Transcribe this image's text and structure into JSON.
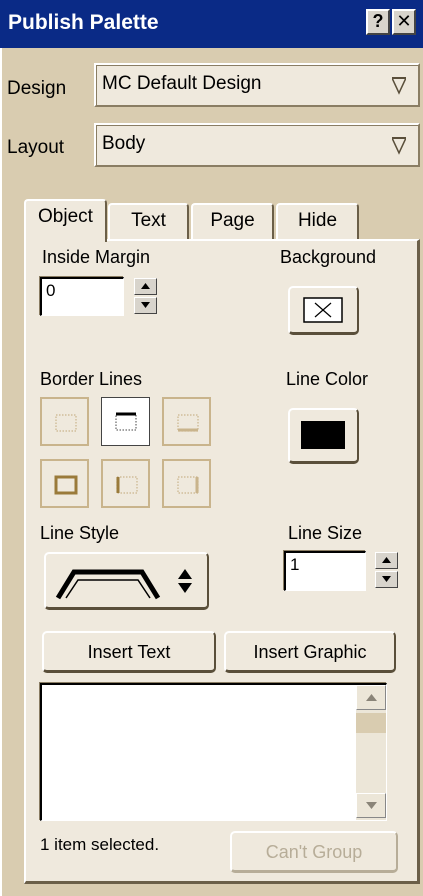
{
  "window": {
    "title": "Publish Palette",
    "help_label": "?",
    "close_label": "✕"
  },
  "design": {
    "label": "Design",
    "value": "MC Default Design"
  },
  "layout": {
    "label": "Layout",
    "value": "Body"
  },
  "tabs": [
    {
      "label": "Object",
      "active": true
    },
    {
      "label": "Text"
    },
    {
      "label": "Page"
    },
    {
      "label": "Hide"
    }
  ],
  "object_panel": {
    "inside_margin": {
      "label": "Inside Margin",
      "value": "0"
    },
    "background": {
      "label": "Background",
      "icon": "no-fill-x-icon"
    },
    "border_lines": {
      "label": "Border Lines",
      "icons": [
        "border-left-icon",
        "border-top-icon",
        "border-bottom-icon",
        "border-box-icon",
        "border-sides-icon",
        "border-right-icon"
      ],
      "selected": "border-top-icon"
    },
    "line_color": {
      "label": "Line Color",
      "value": "#000000"
    },
    "line_style": {
      "label": "Line Style",
      "icon": "line-style-icon"
    },
    "line_size": {
      "label": "Line Size",
      "value": "1"
    },
    "insert_text_label": "Insert Text",
    "insert_graphic_label": "Insert Graphic",
    "status": "1 item selected.",
    "group_label": "Can't Group"
  },
  "colors": {
    "title_bar": "#0a2a86",
    "panel_bg": "#efe9dd",
    "outer_bg": "#d9ccb0"
  }
}
